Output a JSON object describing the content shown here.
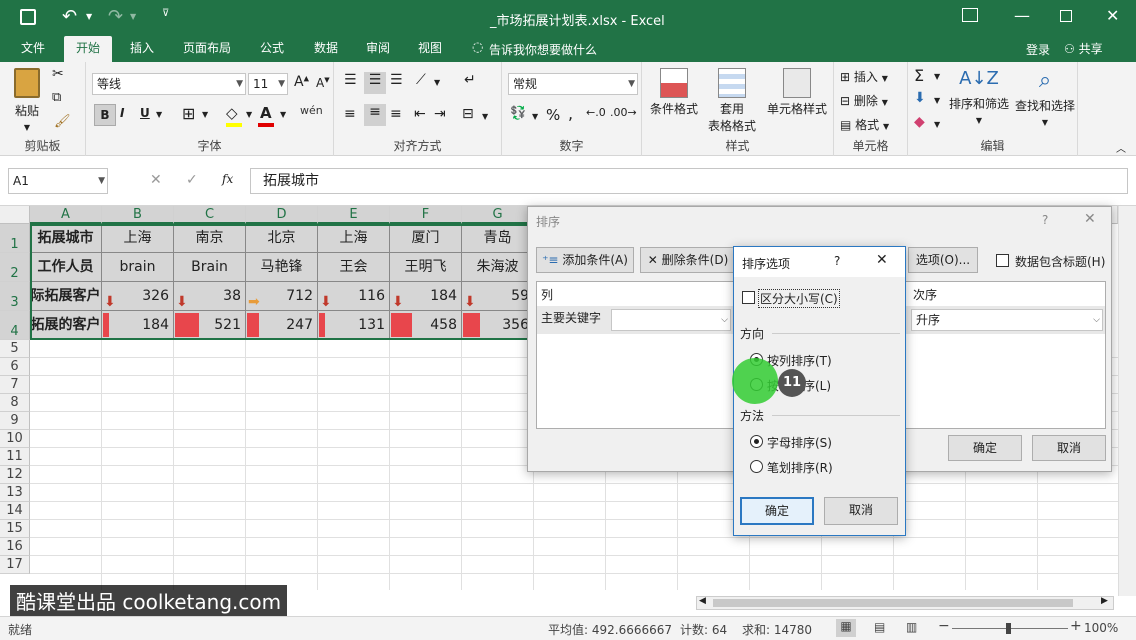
{
  "titlebar": {
    "filename": "_市场拓展计划表.xlsx - Excel"
  },
  "tabs": [
    "文件",
    "开始",
    "插入",
    "页面布局",
    "公式",
    "数据",
    "审阅",
    "视图"
  ],
  "tellme": "告诉我你想要做什么",
  "login": "登录",
  "share": "共享",
  "ribbon": {
    "paste": "粘贴",
    "clipboard": "剪贴板",
    "font_name": "等线",
    "font_size": "11",
    "font_group": "字体",
    "bold": "B",
    "italic": "I",
    "underline": "U",
    "align_group": "对齐方式",
    "number_format": "常规",
    "number_group": "数字",
    "percent": "%",
    "cond_format": "条件格式",
    "table_format_1": "套用",
    "table_format_2": "表格格式",
    "cell_style": "单元格样式",
    "style_group": "样式",
    "insert": "插入",
    "delete": "删除",
    "format": "格式",
    "cells_group": "单元格",
    "sort_filter": "排序和筛选",
    "find_select": "查找和选择",
    "edit_group": "编辑"
  },
  "formula": {
    "namebox": "A1",
    "fx": "fx",
    "value": "拓展城市"
  },
  "columns": [
    "A",
    "B",
    "C",
    "D",
    "E",
    "F",
    "G"
  ],
  "rows": [
    "1",
    "2",
    "3",
    "4",
    "5",
    "6",
    "7",
    "8",
    "9",
    "10",
    "11",
    "12",
    "13",
    "14",
    "15",
    "16",
    "17"
  ],
  "table": {
    "r1": [
      "拓展城市",
      "上海",
      "南京",
      "北京",
      "上海",
      "厦门",
      "青岛"
    ],
    "r2": [
      "工作人员",
      "brain",
      "Brain",
      "马艳锋",
      "王会",
      "王明飞",
      "朱海波"
    ],
    "r3": [
      "际拓展客户",
      "326",
      "38",
      "712",
      "116",
      "184",
      "59"
    ],
    "r4": [
      "拓展的客户",
      "184",
      "521",
      "247",
      "131",
      "458",
      "356"
    ]
  },
  "bar_levels": [
    0.08,
    0.33,
    0.16,
    0.08,
    0.29,
    0.23
  ],
  "sort_dialog": {
    "title": "排序",
    "help": "?",
    "close": "✕",
    "add": "添加条件(A)",
    "delete": "删除条件(D)",
    "options": "选项(O)...",
    "header_chk": "数据包含标题(H)",
    "col_header": "列",
    "order_header": "次序",
    "main_key": "主要关键字",
    "order_value": "升序",
    "ok": "确定",
    "cancel": "取消"
  },
  "options_dialog": {
    "title": "排序选项",
    "help": "?",
    "close": "✕",
    "case": "区分大小写(C)",
    "direction": "方向",
    "by_col": "按列排序(T)",
    "by_row": "按行排序(L)",
    "method": "方法",
    "alpha": "字母排序(S)",
    "stroke": "笔划排序(R)",
    "ok": "确定",
    "cancel": "取消"
  },
  "step_badge": "11",
  "watermark": "酷课堂出品 coolketang.com",
  "status": {
    "ready": "就绪",
    "avg": "平均值: 492.6666667",
    "count": "计数: 64",
    "sum": "求和: 14780",
    "zoom": "100%"
  },
  "colors": {
    "excel_green": "#217346",
    "red_bar": "#e8464c",
    "arrow_red": "#c0392b",
    "arrow_orange": "#e89c3a",
    "highlight": "#33cc33"
  }
}
